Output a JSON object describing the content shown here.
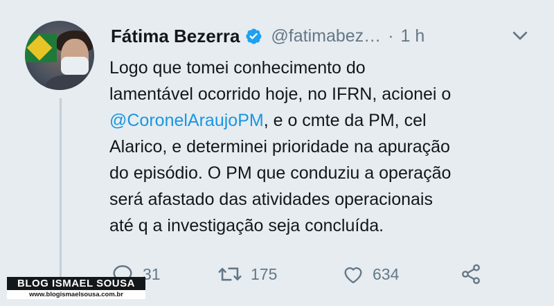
{
  "tweet": {
    "author_name": "Fátima Bezerra",
    "handle": "@fatimabez…",
    "separator": "·",
    "time": "1 h",
    "text_lines": [
      "Logo que tomei conhecimento do",
      "lamentável ocorrido hoje, no IFRN, acionei o",
      "e o cmte da PM, cel",
      "Alarico, e determinei prioridade na apuração",
      "do episódio. O PM que conduziu a operação",
      "será afastado das atividades operacionais",
      "até q a investigação seja concluída."
    ],
    "mention": "@CoronelAraujoPM",
    "mention_suffix": ",",
    "replies": "31",
    "retweets": "175",
    "likes": "634",
    "icons": {
      "verified": "verified-badge-icon",
      "caret": "chevron-down-icon",
      "reply": "reply-icon",
      "retweet": "retweet-icon",
      "like": "heart-icon",
      "share": "share-icon"
    },
    "colors": {
      "background": "#e6ecf0",
      "link": "#1b95e0",
      "muted": "#657786",
      "verified": "#1da1f2"
    }
  },
  "watermark": {
    "title": "BLOG ISMAEL SOUSA",
    "url": "www.blogismaelsousa.com.br"
  }
}
